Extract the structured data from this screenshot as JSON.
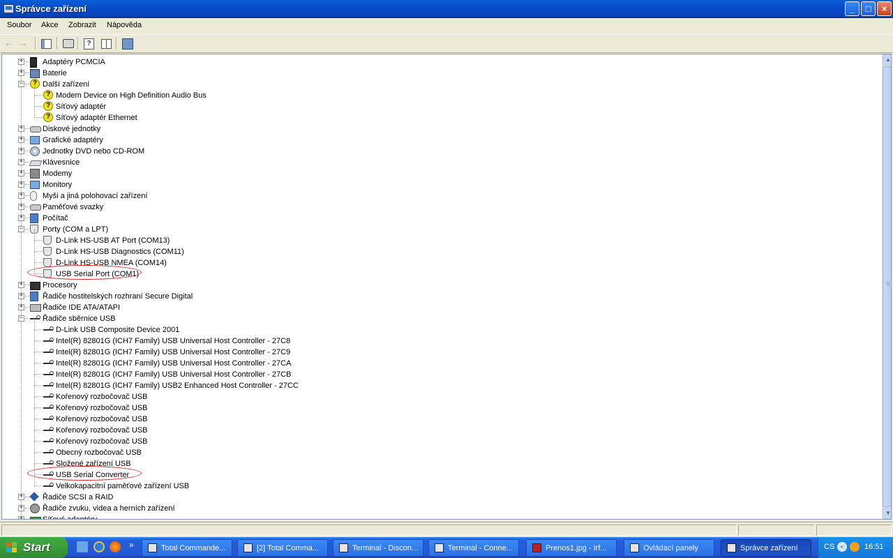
{
  "window": {
    "title": "Správce zařízení"
  },
  "menu": [
    "Soubor",
    "Akce",
    "Zobrazit",
    "Nápověda"
  ],
  "tree": [
    {
      "label": "Adaptéry PCMCIA",
      "level": 0,
      "state": "collapsed",
      "icon": "pcmcia-icon"
    },
    {
      "label": "Baterie",
      "level": 0,
      "state": "collapsed",
      "icon": "battery-icon"
    },
    {
      "label": "Další zařízení",
      "level": 0,
      "state": "expanded",
      "icon": "unknown-device-icon"
    },
    {
      "label": "Modem Device on High Definition Audio Bus",
      "level": 1,
      "icon": "warning-device-icon"
    },
    {
      "label": "Síťový adaptér",
      "level": 1,
      "icon": "warning-device-icon"
    },
    {
      "label": "Síťový adaptér Ethernet",
      "level": 1,
      "icon": "warning-device-icon"
    },
    {
      "label": "Diskové jednotky",
      "level": 0,
      "state": "collapsed",
      "icon": "disk-drive-icon"
    },
    {
      "label": "Grafické adaptéry",
      "level": 0,
      "state": "collapsed",
      "icon": "display-adapter-icon"
    },
    {
      "label": "Jednotky DVD nebo CD-ROM",
      "level": 0,
      "state": "collapsed",
      "icon": "cdrom-icon"
    },
    {
      "label": "Klávesnice",
      "level": 0,
      "state": "collapsed",
      "icon": "keyboard-icon"
    },
    {
      "label": "Modemy",
      "level": 0,
      "state": "collapsed",
      "icon": "modem-icon"
    },
    {
      "label": "Monitory",
      "level": 0,
      "state": "collapsed",
      "icon": "monitor-icon"
    },
    {
      "label": "Myši a jiná polohovací zařízení",
      "level": 0,
      "state": "collapsed",
      "icon": "mouse-icon"
    },
    {
      "label": "Paměťové svazky",
      "level": 0,
      "state": "collapsed",
      "icon": "storage-volume-icon"
    },
    {
      "label": "Počítač",
      "level": 0,
      "state": "collapsed",
      "icon": "computer-icon"
    },
    {
      "label": "Porty (COM a LPT)",
      "level": 0,
      "state": "expanded",
      "icon": "port-icon"
    },
    {
      "label": "D-Link HS-USB AT Port (COM13)",
      "level": 1,
      "icon": "port-icon"
    },
    {
      "label": "D-Link HS-USB Diagnostics (COM11)",
      "level": 1,
      "icon": "port-icon"
    },
    {
      "label": "D-Link HS-USB NMEA (COM14)",
      "level": 1,
      "icon": "port-icon"
    },
    {
      "label": "USB Serial Port (COM1)",
      "level": 1,
      "icon": "port-icon",
      "circled": true
    },
    {
      "label": "Procesory",
      "level": 0,
      "state": "collapsed",
      "icon": "processor-icon"
    },
    {
      "label": "Řadiče hostitelských rozhraní Secure Digital",
      "level": 0,
      "state": "collapsed",
      "icon": "sd-host-icon"
    },
    {
      "label": "Řadiče IDE ATA/ATAPI",
      "level": 0,
      "state": "collapsed",
      "icon": "ide-controller-icon"
    },
    {
      "label": "Řadiče sběrnice USB",
      "level": 0,
      "state": "expanded",
      "icon": "usb-icon"
    },
    {
      "label": "D-Link USB Composite Device 2001",
      "level": 1,
      "icon": "usb-icon"
    },
    {
      "label": "Intel(R) 82801G (ICH7 Family) USB Universal Host Controller - 27C8",
      "level": 1,
      "icon": "usb-icon"
    },
    {
      "label": "Intel(R) 82801G (ICH7 Family) USB Universal Host Controller - 27C9",
      "level": 1,
      "icon": "usb-icon"
    },
    {
      "label": "Intel(R) 82801G (ICH7 Family) USB Universal Host Controller - 27CA",
      "level": 1,
      "icon": "usb-icon"
    },
    {
      "label": "Intel(R) 82801G (ICH7 Family) USB Universal Host Controller - 27CB",
      "level": 1,
      "icon": "usb-icon"
    },
    {
      "label": "Intel(R) 82801G (ICH7 Family) USB2 Enhanced Host Controller - 27CC",
      "level": 1,
      "icon": "usb-icon"
    },
    {
      "label": "Kořenový rozbočovač USB",
      "level": 1,
      "icon": "usb-icon"
    },
    {
      "label": "Kořenový rozbočovač USB",
      "level": 1,
      "icon": "usb-icon"
    },
    {
      "label": "Kořenový rozbočovač USB",
      "level": 1,
      "icon": "usb-icon"
    },
    {
      "label": "Kořenový rozbočovač USB",
      "level": 1,
      "icon": "usb-icon"
    },
    {
      "label": "Kořenový rozbočovač USB",
      "level": 1,
      "icon": "usb-icon"
    },
    {
      "label": "Obecný rozbočovač USB",
      "level": 1,
      "icon": "usb-icon"
    },
    {
      "label": "Složené zařízení USB",
      "level": 1,
      "icon": "usb-icon"
    },
    {
      "label": "USB Serial Converter",
      "level": 1,
      "icon": "usb-icon",
      "circled": true
    },
    {
      "label": "Velkokapacitní paměťové zařízení USB",
      "level": 1,
      "icon": "usb-icon"
    },
    {
      "label": "Řadiče SCSI a RAID",
      "level": 0,
      "state": "collapsed",
      "icon": "scsi-icon"
    },
    {
      "label": "Řadiče zvuku, videa a herních zařízení",
      "level": 0,
      "state": "collapsed",
      "icon": "sound-icon"
    },
    {
      "label": "Síťové adaptéry",
      "level": 0,
      "state": "collapsed",
      "icon": "network-adapter-icon"
    }
  ],
  "taskbar": {
    "start_label": "Start",
    "tasks": [
      {
        "label": "Total Commande...",
        "active": false
      },
      {
        "label": "[2] Total Comma...",
        "active": false
      },
      {
        "label": "Terminal - Discon...",
        "active": false
      },
      {
        "label": "Terminal - Conne...",
        "active": false
      },
      {
        "label": "Prenos1.jpg - Irf...",
        "active": false
      },
      {
        "label": "Ovládací panely",
        "active": false
      },
      {
        "label": "Správce zařízení",
        "active": true
      }
    ],
    "language": "CS",
    "clock": "16:51",
    "overflow_glyph": "»"
  },
  "colors": {
    "annotation_circle": "#d42020",
    "title_bar": "#0a4ccc",
    "taskbar": "#245edb"
  }
}
